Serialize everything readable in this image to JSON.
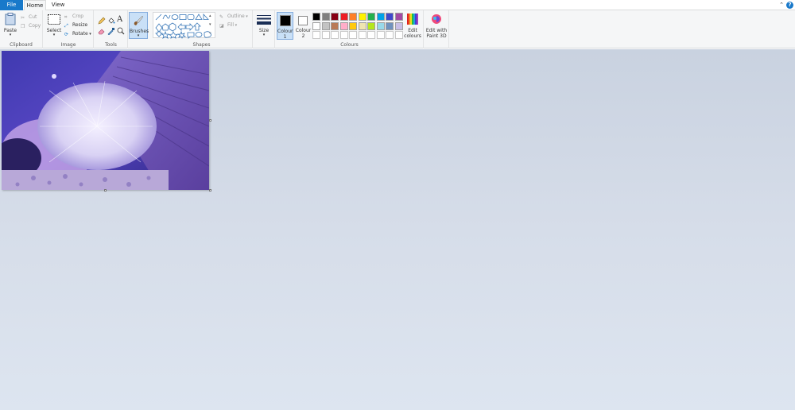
{
  "tabs": {
    "file": "File",
    "home": "Home",
    "view": "View"
  },
  "window": {
    "collapse_glyph": "⌃",
    "help_glyph": "?"
  },
  "clipboard": {
    "label": "Clipboard",
    "paste": "Paste",
    "cut": "Cut",
    "copy": "Copy"
  },
  "image": {
    "label": "Image",
    "select": "Select",
    "crop": "Crop",
    "resize": "Resize",
    "rotate": "Rotate"
  },
  "tools": {
    "label": "Tools",
    "text_glyph": "A"
  },
  "brushes": {
    "label": "Brushes"
  },
  "shapes": {
    "label": "Shapes",
    "outline": "Outline",
    "fill": "Fill"
  },
  "size": {
    "label": "Size"
  },
  "colours": {
    "label": "Colours",
    "colour1": "Colour 1",
    "colour2": "Colour 2",
    "colour1_value": "#000000",
    "colour2_value": "#ffffff",
    "edit": "Edit colours",
    "palette_row1": [
      "#000000",
      "#7f7f7f",
      "#880015",
      "#ed1c24",
      "#ff7f27",
      "#fff200",
      "#22b14c",
      "#00a2e8",
      "#3f48cc",
      "#a349a4"
    ],
    "palette_row2": [
      "#ffffff",
      "#c3c3c3",
      "#b97a57",
      "#ffaec9",
      "#ffc90e",
      "#efe4b0",
      "#b5e61d",
      "#99d9ea",
      "#7092be",
      "#c8bfe7"
    ]
  },
  "paint3d": {
    "label": "Edit with Paint 3D"
  },
  "icons": {
    "paste": "clipboard-paste-icon",
    "cut": "scissors-icon",
    "copy": "copy-icon",
    "select": "selection-rectangle-icon",
    "crop": "crop-icon",
    "resize": "resize-icon",
    "rotate": "rotate-icon",
    "pencil": "pencil-icon",
    "fill": "fill-bucket-icon",
    "text": "text-icon",
    "eraser": "eraser-icon",
    "picker": "color-picker-icon",
    "magnifier": "magnifier-icon",
    "brush": "brush-icon",
    "size": "line-size-icon",
    "edit_colours": "color-wheel-icon",
    "paint3d": "paint-3d-icon"
  }
}
